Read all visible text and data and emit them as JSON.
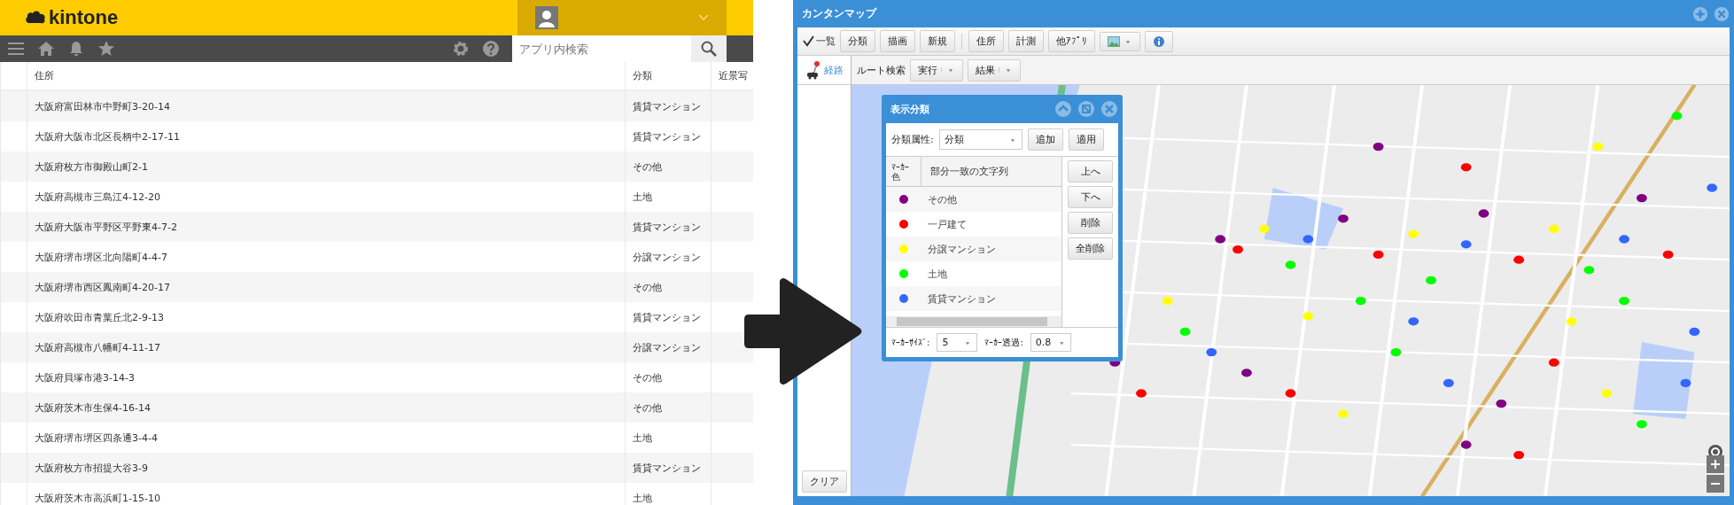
{
  "kintone": {
    "logo": "kintone",
    "search": {
      "placeholder": "アプリ内検索"
    },
    "table": {
      "columns": [
        "住所",
        "分類",
        "近景写"
      ],
      "rows": [
        {
          "address": "大阪府富田林市中野町3-20-14",
          "category": "賃貸マンション"
        },
        {
          "address": "大阪府大阪市北区長柄中2-17-11",
          "category": "賃貸マンション"
        },
        {
          "address": "大阪府枚方市御殿山町2-1",
          "category": "その他"
        },
        {
          "address": "大阪府高槻市三島江4-12-20",
          "category": "土地"
        },
        {
          "address": "大阪府大阪市平野区平野東4-7-2",
          "category": "賃貸マンション"
        },
        {
          "address": "大阪府堺市堺区北向陽町4-4-7",
          "category": "分譲マンション"
        },
        {
          "address": "大阪府堺市西区鳳南町4-20-17",
          "category": "その他"
        },
        {
          "address": "大阪府吹田市青葉丘北2-9-13",
          "category": "賃貸マンション"
        },
        {
          "address": "大阪府高槻市八幡町4-11-17",
          "category": "分譲マンション"
        },
        {
          "address": "大阪府貝塚市港3-14-3",
          "category": "その他"
        },
        {
          "address": "大阪府茨木市生保4-16-14",
          "category": "その他"
        },
        {
          "address": "大阪府堺市堺区四条通3-4-4",
          "category": "土地"
        },
        {
          "address": "大阪府枚方市招提大谷3-9",
          "category": "賃貸マンション"
        },
        {
          "address": "大阪府茨木市高浜町1-15-10",
          "category": "土地"
        }
      ]
    }
  },
  "map_window": {
    "title": "カンタンマップ",
    "toolbar": {
      "list_checkbox": {
        "label": "一覧",
        "checked": true
      },
      "button_groups": [
        [
          "分類",
          "描画",
          "新規"
        ],
        [
          "住所",
          "計測",
          "他ｱﾌﾟﾘ"
        ]
      ]
    },
    "route": {
      "label": "経路",
      "search_label": "ルート検索",
      "buttons": [
        "実行",
        "結果"
      ]
    },
    "clear_button": "クリア",
    "category_dialog": {
      "title": "表示分類",
      "attribute_label": "分類属性:",
      "attribute_value": "分類",
      "buttons": [
        "追加",
        "適用"
      ],
      "columns": [
        "ﾏｰｶｰ色",
        "部分一致の文字列"
      ],
      "rows": [
        {
          "label": "その他",
          "color": "#800080"
        },
        {
          "label": "一戸建て",
          "color": "#ff0000"
        },
        {
          "label": "分譲マンション",
          "color": "#ffff00"
        },
        {
          "label": "土地",
          "color": "#00ff00"
        },
        {
          "label": "賃貸マンション",
          "color": "#3366ff"
        }
      ],
      "side_buttons": [
        "上へ",
        "下へ",
        "削除",
        "全削除"
      ],
      "marker_size_label": "ﾏｰｶｰｻｲｽﾞ:",
      "marker_size": "5",
      "opacity_label": "ﾏｰｶｰ透過:",
      "opacity": "0.8"
    }
  }
}
